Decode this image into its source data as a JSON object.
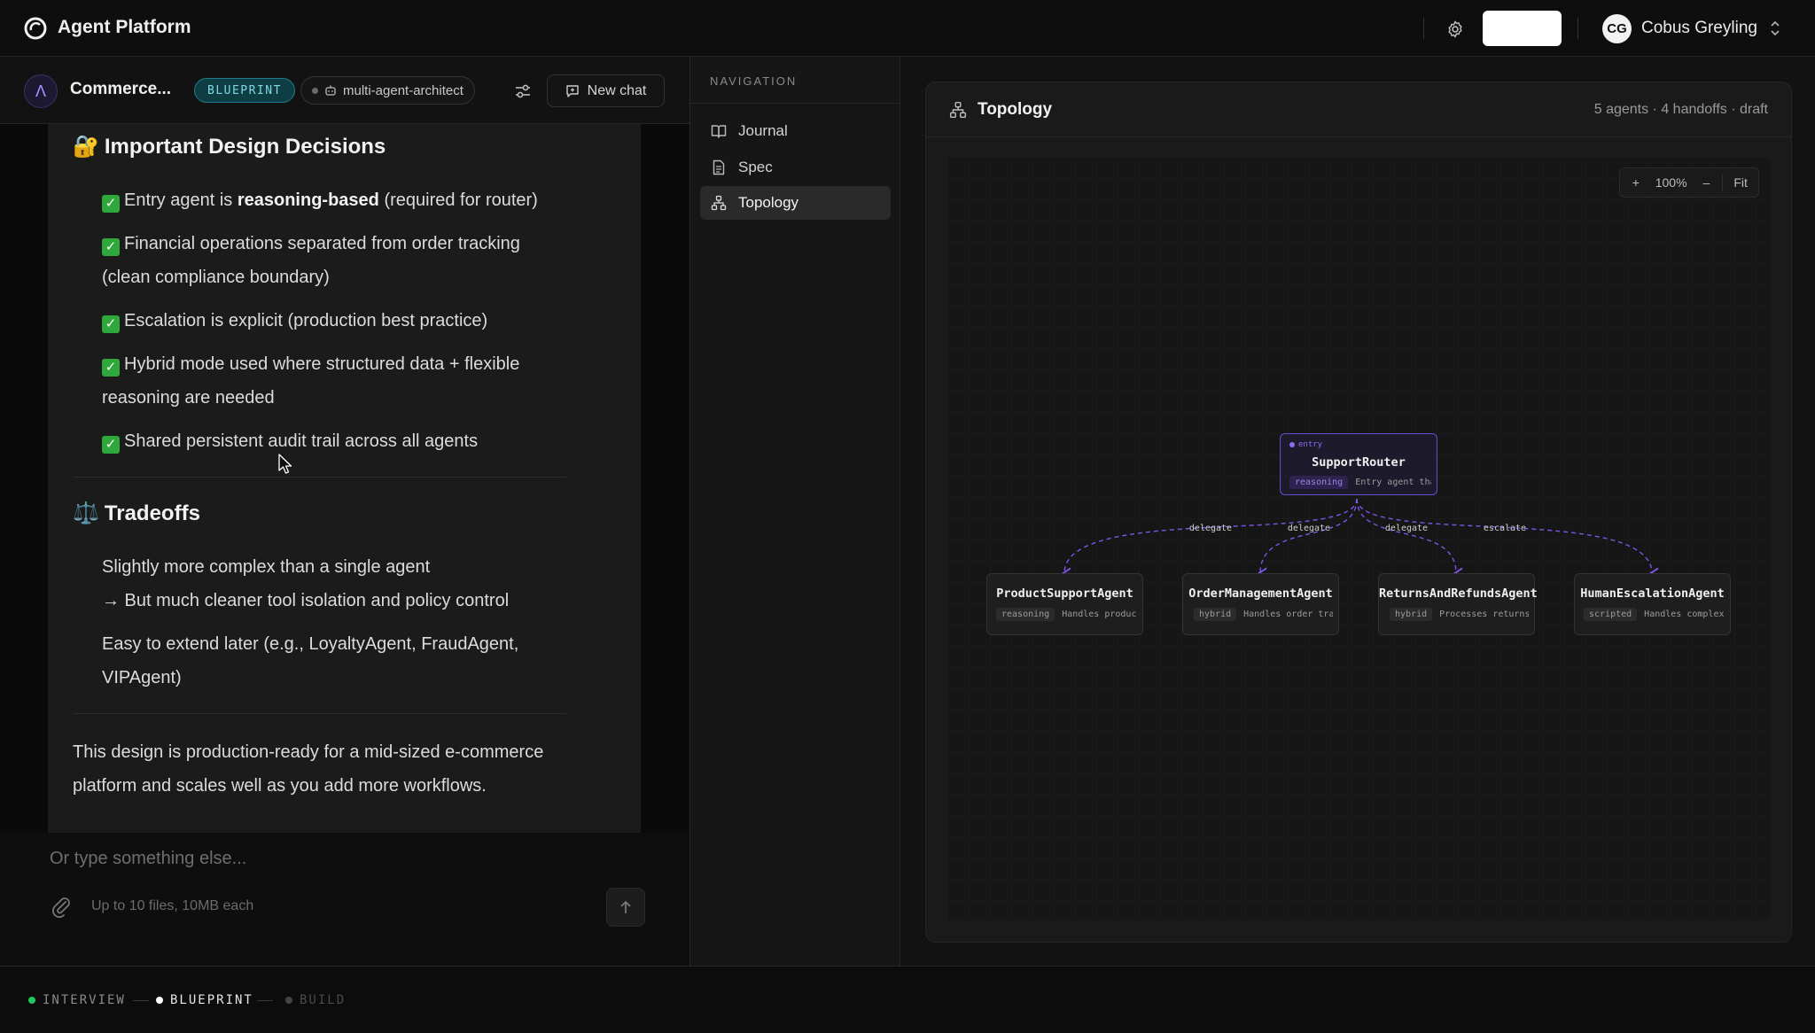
{
  "topbar": {
    "app_title": "Agent Platform",
    "user_initials": "CG",
    "user_name": "Cobus Greyling"
  },
  "chat_header": {
    "project_initial": "Λ",
    "project_name": "Commerce...",
    "phase_badge": "BLUEPRINT",
    "agent_chip": "multi-agent-architect",
    "new_chat_label": "New chat"
  },
  "message": {
    "decisions_heading": "Important Design Decisions",
    "decisions_icon": "🔐",
    "decisions": [
      {
        "before": "Entry agent is ",
        "bold": "reasoning-based",
        "after": " (required for router)"
      },
      {
        "text": "Financial operations separated from order tracking (clean compliance boundary)"
      },
      {
        "text": "Escalation is explicit (production best practice)"
      },
      {
        "text": "Hybrid mode used where structured data + flexible reasoning are needed"
      },
      {
        "text": "Shared persistent audit trail across all agents"
      }
    ],
    "tradeoffs_heading": "Tradeoffs",
    "tradeoffs_icon": "⚖️",
    "tradeoff_1a": "Slightly more complex than a single agent",
    "tradeoff_1b": "→ But much cleaner tool isolation and policy control",
    "tradeoff_2": "Easy to extend later (e.g., LoyaltyAgent, FraudAgent, VIPAgent)",
    "closing": "This design is production-ready for a mid-sized e-commerce platform and scales well as you add more workflows."
  },
  "composer": {
    "placeholder": "Or type something else...",
    "upload_hint": "Up to 10 files, 10MB each"
  },
  "progress_steps": [
    {
      "label": "INTERVIEW",
      "state": "done",
      "color": "#22c55e"
    },
    {
      "label": "BLUEPRINT",
      "state": "active",
      "color": "#ffffff"
    },
    {
      "label": "BUILD",
      "state": "pending",
      "color": "#444444"
    }
  ],
  "navigation": {
    "heading": "NAVIGATION",
    "items": [
      {
        "label": "Journal",
        "icon": "book-icon"
      },
      {
        "label": "Spec",
        "icon": "document-icon"
      },
      {
        "label": "Topology",
        "icon": "topology-icon",
        "active": true
      }
    ]
  },
  "topology": {
    "title": "Topology",
    "stats": "5 agents · 4 handoffs · draft",
    "zoom_in": "+",
    "zoom_level": "100%",
    "zoom_out": "–",
    "fit": "Fit",
    "entry_label": "entry",
    "nodes": {
      "router": {
        "name": "SupportRouter",
        "mode": "reasoning",
        "desc": "Entry agent that cla"
      },
      "product": {
        "name": "ProductSupportAgent",
        "mode": "reasoning",
        "desc": "Handles product ques"
      },
      "order": {
        "name": "OrderManagementAgent",
        "mode": "hybrid",
        "desc": "Handles order tracki"
      },
      "returns": {
        "name": "ReturnsAndRefundsAgent",
        "mode": "hybrid",
        "desc": "Processes returns, r"
      },
      "human": {
        "name": "HumanEscalationAgent",
        "mode": "scripted",
        "desc": "Handles complex or s"
      }
    },
    "edges": {
      "e1": "delegate",
      "e2": "delegate",
      "e3": "delegate",
      "e4": "escalate"
    },
    "edge_color": "#7c55e6"
  }
}
